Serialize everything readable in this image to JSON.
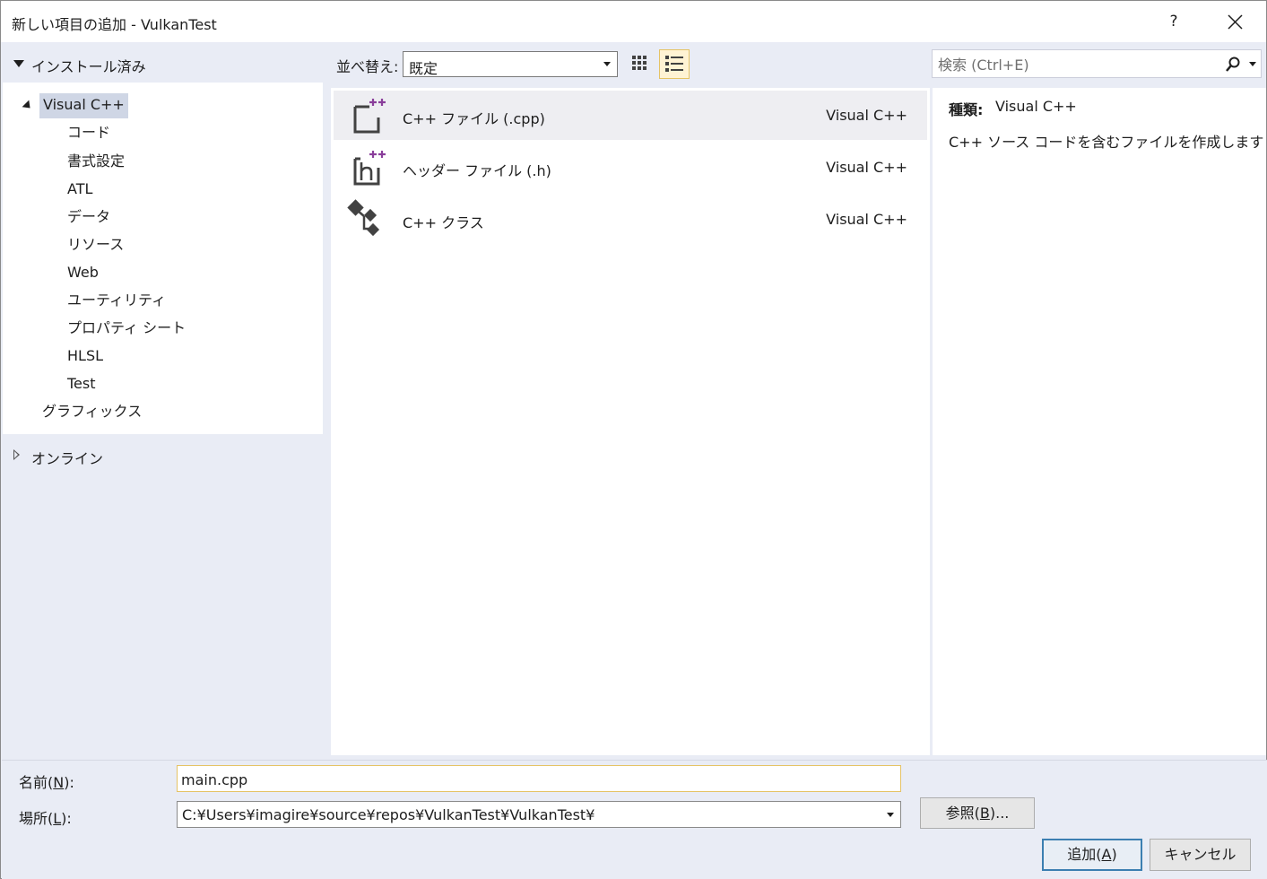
{
  "window": {
    "title": "新しい項目の追加 - VulkanTest",
    "help_label": "?"
  },
  "left": {
    "installed_label": "インストール済み",
    "tree": {
      "root_label": "Visual C++",
      "children": [
        "コード",
        "書式設定",
        "ATL",
        "データ",
        "リソース",
        "Web",
        "ユーティリティ",
        "プロパティ シート",
        "HLSL",
        "Test"
      ],
      "graphics_label": "グラフィックス"
    },
    "online_label": "オンライン"
  },
  "toolbar": {
    "sort_label": "並べ替え:",
    "sort_value": "既定"
  },
  "search": {
    "placeholder": "検索 (Ctrl+E)"
  },
  "templates": [
    {
      "name": "C++ ファイル (.cpp)",
      "lang": "Visual C++",
      "icon": "cpp-file-icon",
      "selected": true
    },
    {
      "name": "ヘッダー ファイル (.h)",
      "lang": "Visual C++",
      "icon": "header-file-icon",
      "selected": false
    },
    {
      "name": "C++ クラス",
      "lang": "Visual C++",
      "icon": "cpp-class-icon",
      "selected": false
    }
  ],
  "details": {
    "kind_label": "種類:",
    "kind_value": "Visual C++",
    "description": "C++ ソース コードを含むファイルを作成します"
  },
  "form": {
    "name_label_pre": "名前(",
    "name_label_key": "N",
    "name_label_post": "):",
    "name_value": "main.cpp",
    "location_label_pre": "場所(",
    "location_label_key": "L",
    "location_label_post": "):",
    "location_value": "C:¥Users¥imagire¥source¥repos¥VulkanTest¥VulkanTest¥",
    "browse_pre": "参照(",
    "browse_key": "B",
    "browse_post": ")..."
  },
  "buttons": {
    "add_pre": "追加(",
    "add_key": "A",
    "add_post": ")",
    "cancel": "キャンセル"
  },
  "colors": {
    "accent_purple": "#8a3f9b",
    "icon_dark": "#424242",
    "selection_border": "#e5c365"
  }
}
